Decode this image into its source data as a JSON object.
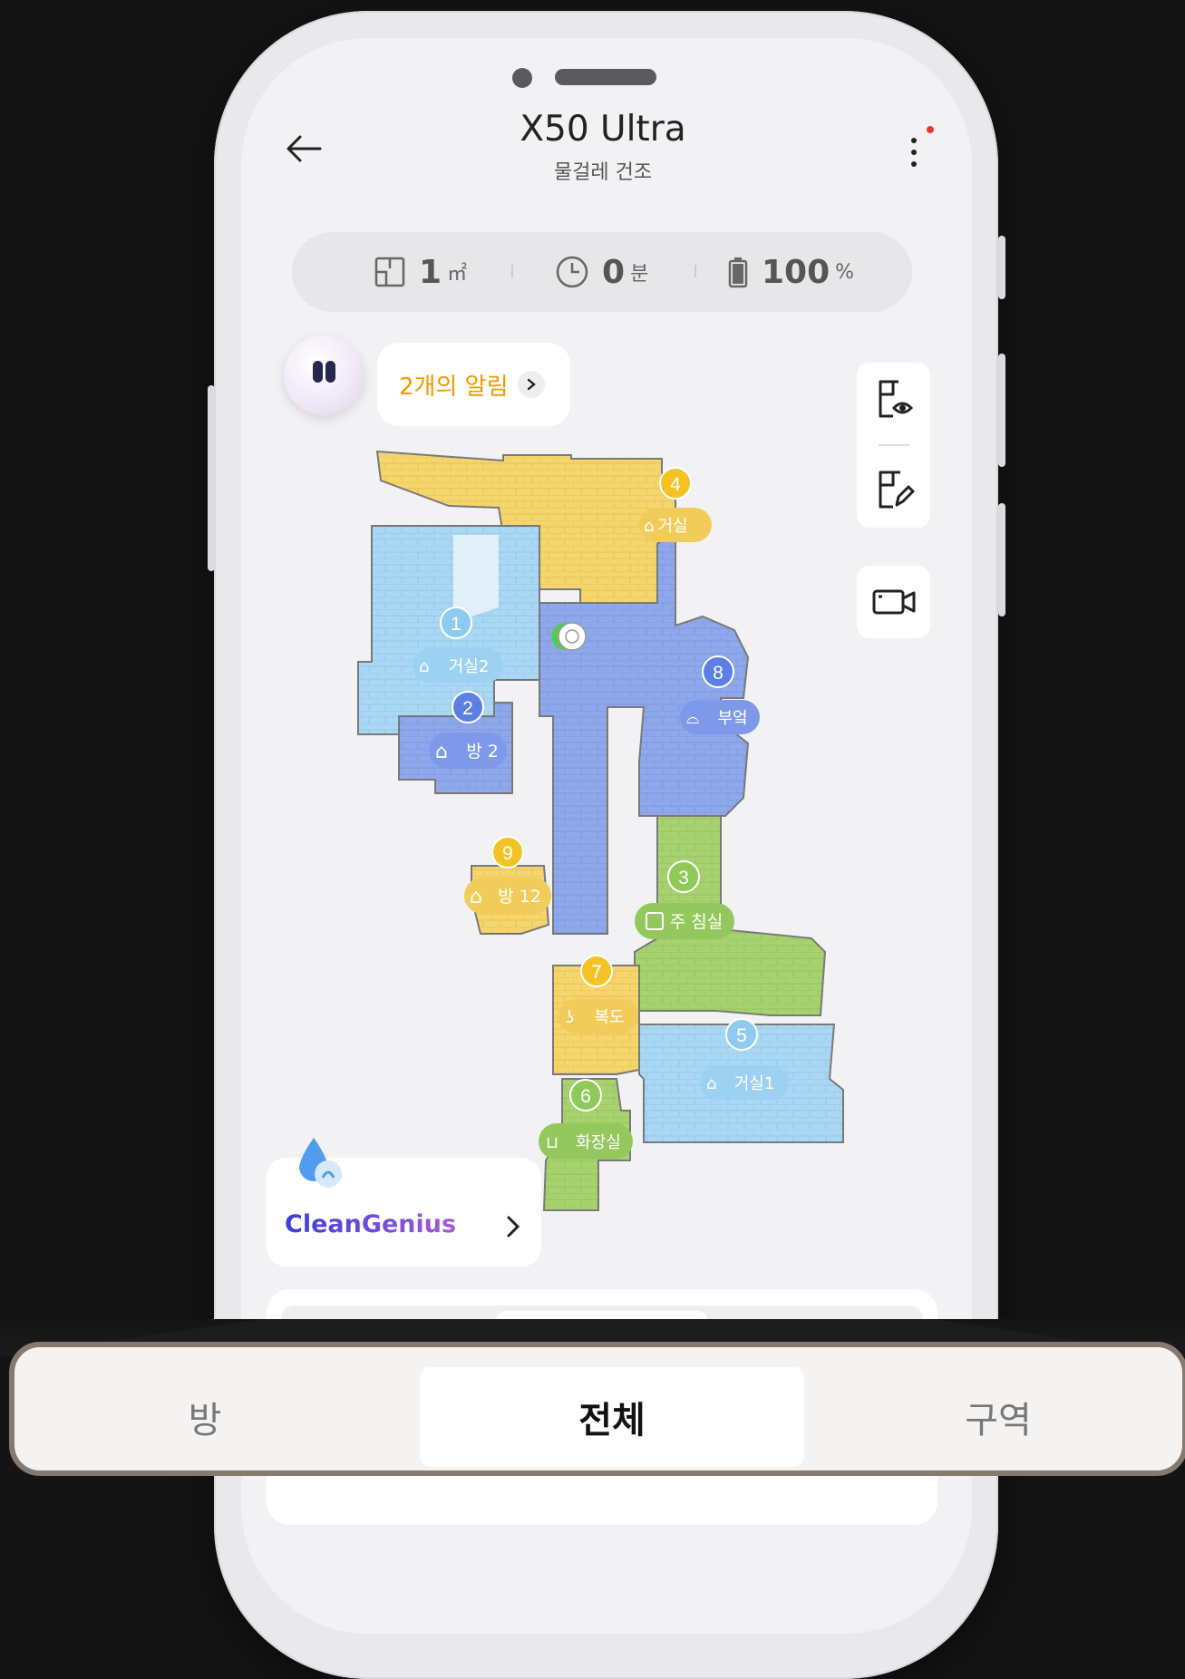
{
  "header": {
    "title": "X50 Ultra",
    "subtitle": "물걸레 건조"
  },
  "stats": [
    {
      "icon": "area-icon",
      "value": "1",
      "unit": "㎡"
    },
    {
      "icon": "clock-icon",
      "value": "0",
      "unit": "분"
    },
    {
      "icon": "battery-icon",
      "value": "100",
      "unit": "%"
    }
  ],
  "alert": {
    "label": "2개의 알림"
  },
  "rooms": [
    {
      "number": "1",
      "name": "거실2",
      "color": "#a9d8f6"
    },
    {
      "number": "2",
      "name": "방 2",
      "color": "#8ea8ec"
    },
    {
      "number": "3",
      "name": "주 침실",
      "color": "#a7d36f"
    },
    {
      "number": "4",
      "name": "거실",
      "color": "#f6d56b"
    },
    {
      "number": "5",
      "name": "거실1",
      "color": "#a9d8f6"
    },
    {
      "number": "6",
      "name": "화장실",
      "color": "#a7d36f"
    },
    {
      "number": "7",
      "name": "복도",
      "color": "#f6d56b"
    },
    {
      "number": "8",
      "name": "부엌",
      "color": "#8ea8ec"
    },
    {
      "number": "9",
      "name": "방 12",
      "color": "#f6d56b"
    }
  ],
  "clean_genius": {
    "label": "CleanGenius"
  },
  "tabs": {
    "room": "방",
    "all": "전체",
    "zone": "구역"
  },
  "colors": {
    "accent_orange": "#f39800",
    "notification_dot": "#e53935"
  }
}
